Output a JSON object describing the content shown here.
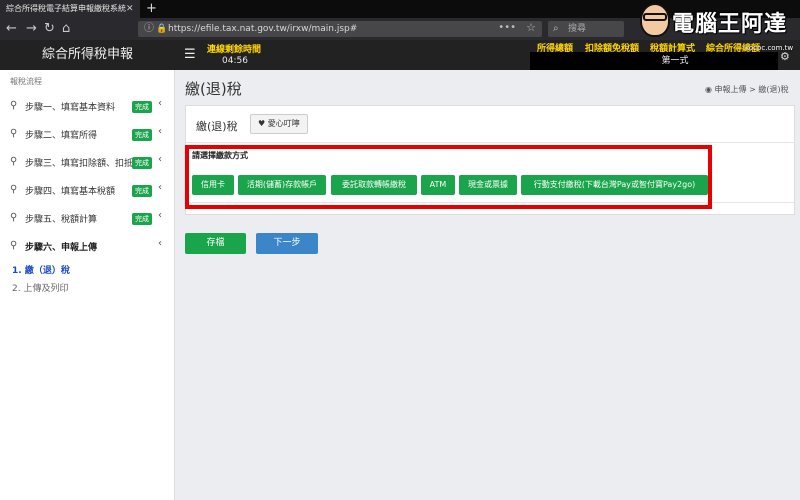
{
  "browser": {
    "tab_title": "綜合所得稅電子結算申報繳稅系統",
    "tab_close": "✕",
    "new_tab": "+",
    "url": "https://efile.tax.nat.gov.tw/irxw/main.jsp#",
    "search_placeholder": "搜尋"
  },
  "header": {
    "brand": "綜合所得稅申報",
    "remaining_label": "連線剩餘時間",
    "remaining_time": "04:56",
    "links": [
      "所得總額",
      "扣除額免稅額",
      "稅額計算式",
      "綜合所得總額"
    ],
    "filing_type": "第一式"
  },
  "sidebar": {
    "heading": "報稅流程",
    "items": [
      {
        "label": "步驟一、填寫基本資料",
        "badge": "完成"
      },
      {
        "label": "步驟二、填寫所得",
        "badge": "完成"
      },
      {
        "label": "步驟三、填寫扣除額、扣抵",
        "badge": "完成"
      },
      {
        "label": "步驟四、填寫基本稅額",
        "badge": "完成"
      },
      {
        "label": "步驟五、稅額計算",
        "badge": "完成"
      },
      {
        "label": "步驟六、申報上傳",
        "badge": ""
      }
    ],
    "subitems": [
      "1. 繳（退）稅",
      "2. 上傳及列印"
    ]
  },
  "main": {
    "title": "繳(退)稅",
    "breadcrumb_root": "申報上傳",
    "breadcrumb_sep": ">",
    "breadcrumb_current": "繳(退)稅",
    "panel_title": "繳(退)稅",
    "love_button": "愛心叮嚀",
    "pay_label": "請選擇繳款方式",
    "pay_methods": [
      "信用卡",
      "活期(儲蓄)存款帳戶",
      "委託取款轉帳繳稅",
      "ATM",
      "現金或票據",
      "行動支付繳稅(下載台灣Pay或智付寶Pay2go)"
    ],
    "save_button": "存檔",
    "next_button": "下一步"
  },
  "watermark": {
    "text": "電腦王阿達",
    "url": "kocpc.com.tw"
  }
}
